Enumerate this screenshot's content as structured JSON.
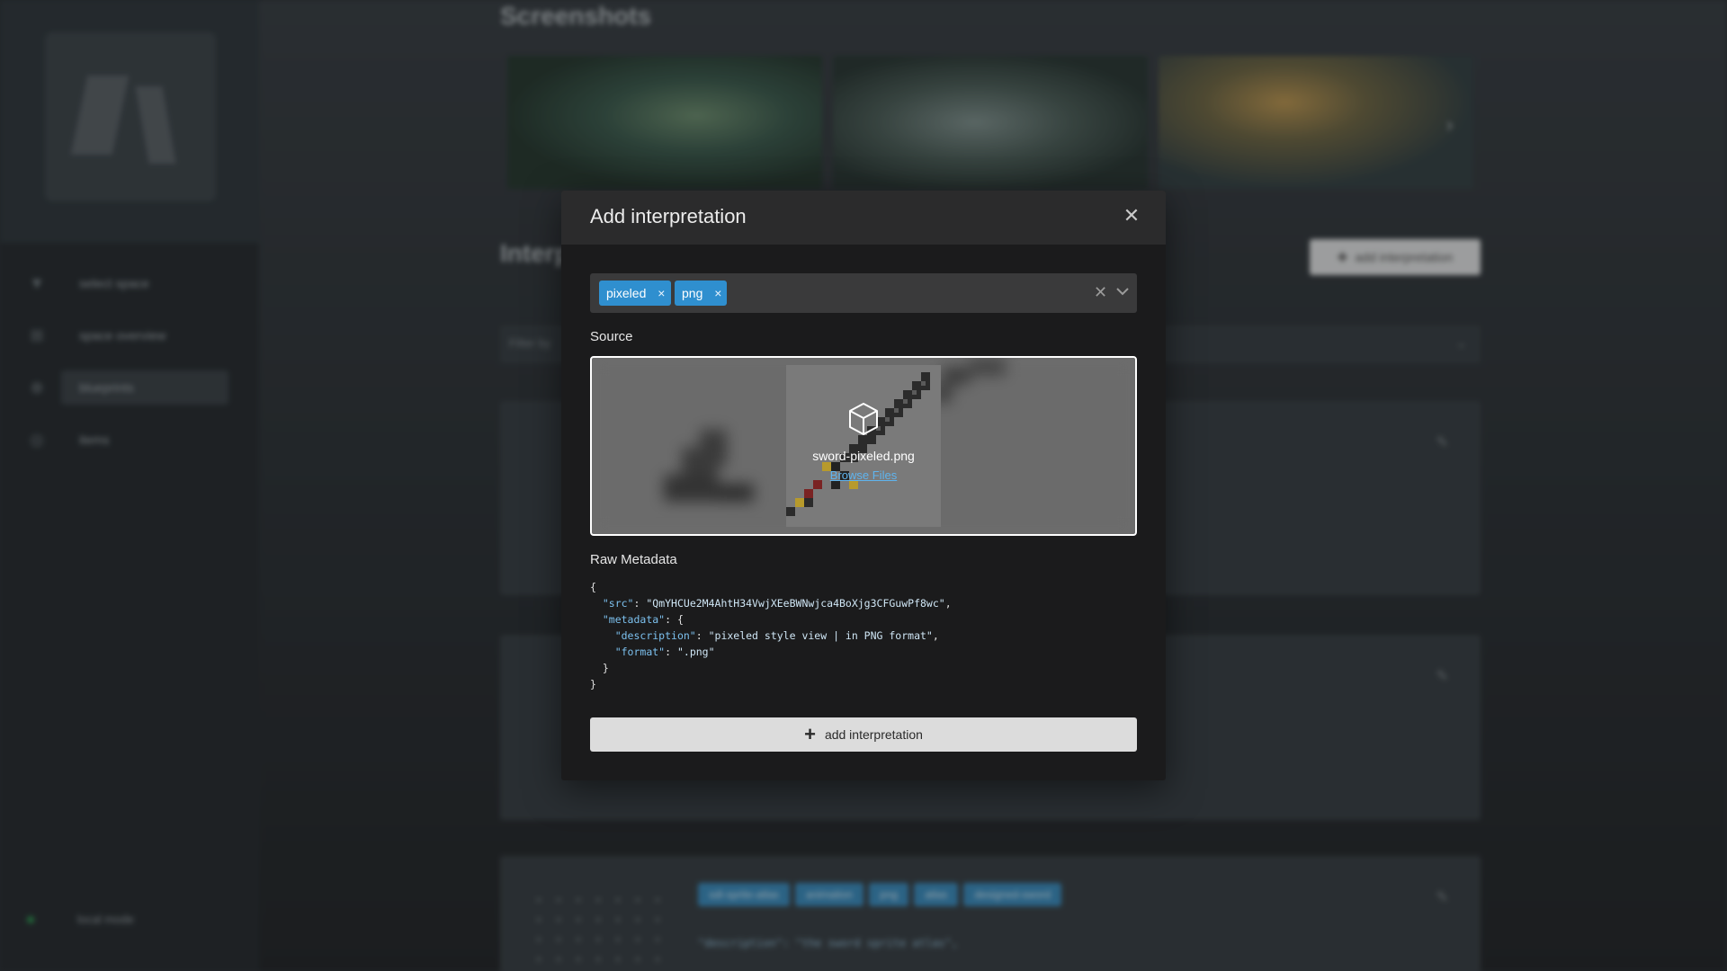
{
  "background": {
    "screenshots_title": "Screenshots",
    "sidebar": {
      "items": [
        {
          "label": "select space",
          "icon": "filter-icon"
        },
        {
          "label": "space overview",
          "icon": "plus-square-icon"
        },
        {
          "label": "blueprints",
          "icon": "crosshair-icon"
        },
        {
          "label": "items",
          "icon": "circle-icon"
        }
      ],
      "local_mode": "local mode"
    },
    "section_title": "Interpretations",
    "add_button": "add interpretation",
    "filter_placeholder": "Filter by",
    "card3_tags": [
      "sdl-sprite-atlas",
      "animation",
      "png",
      "atlas",
      "designed-sword"
    ],
    "card3_code": "\"description\": \"the sword sprite atlas\","
  },
  "modal": {
    "title": "Add interpretation",
    "close_icon": "close-icon",
    "tags": [
      "pixeled",
      "png"
    ],
    "source_label": "Source",
    "file_name": "sword-pixeled.png",
    "browse_label": "Browse Files",
    "raw_metadata_label": "Raw Metadata",
    "metadata": {
      "src": "QmYHCUe2M4AhtH34VwjXEeBWNwjca4BoXjg3CFGuwPf8wc",
      "description": "pixeled style view | in PNG format",
      "format": ".png"
    },
    "submit_label": "add interpretation"
  },
  "colors": {
    "tag_bg": "#2f8fcf",
    "modal_bg": "#1b1b1c",
    "modal_header_bg": "#2b2b2c",
    "accent_link": "#5fb4ee"
  }
}
